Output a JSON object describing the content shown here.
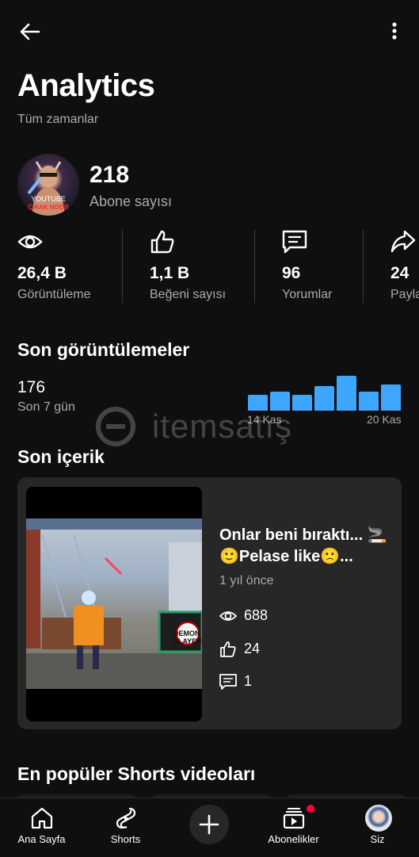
{
  "header": {
    "title": "Analytics",
    "subtitle": "Tüm zamanlar",
    "back_icon": "arrow-left-icon",
    "menu_icon": "more-vertical-icon"
  },
  "channel": {
    "avatar_text_line1": "YOUTUBE",
    "avatar_text_line2": "ÇIRAK NOOB",
    "subscribers": "218",
    "subscribers_label": "Abone sayısı"
  },
  "stats": [
    {
      "icon": "eye-icon",
      "value": "26,4 B",
      "label": "Görüntüleme"
    },
    {
      "icon": "thumbs-up-icon",
      "value": "1,1 B",
      "label": "Beğeni sayısı"
    },
    {
      "icon": "comment-icon",
      "value": "96",
      "label": "Yorumlar"
    },
    {
      "icon": "share-icon",
      "value": "24",
      "label": "Paylaşımlar"
    }
  ],
  "recent_views": {
    "title": "Son görüntülemeler",
    "value": "176",
    "period": "Son 7 gün",
    "start_label": "14 Kas",
    "end_label": "20 Kas",
    "daily_views_relative": [
      0.45,
      0.55,
      0.45,
      0.7,
      1.0,
      0.55,
      0.75
    ],
    "bar_color": "#3ea6ff"
  },
  "watermark": {
    "text": "itemsatış"
  },
  "recent_content": {
    "title": "Son içerik",
    "video": {
      "title": "Onlar beni bıraktı... 🚬🙂Pelase like🙁...",
      "date": "1 yıl önce",
      "thumb_badge": "DEMON SLAYER",
      "views": "688",
      "likes": "24",
      "comments": "1"
    }
  },
  "popular_shorts": {
    "title": "En popüler Shorts videoları"
  },
  "bottom_nav": [
    {
      "icon": "home-icon",
      "label": "Ana Sayfa"
    },
    {
      "icon": "shorts-icon",
      "label": "Shorts"
    },
    {
      "icon": "plus-icon",
      "label": ""
    },
    {
      "icon": "subscriptions-icon",
      "label": "Abonelikler",
      "has_notification": true
    },
    {
      "icon": "avatar",
      "label": "Siz"
    }
  ],
  "colors": {
    "background": "#0f0f0f",
    "card": "#272727",
    "secondary_text": "#aaaaaa",
    "accent": "#3ea6ff",
    "notification": "#ff0033"
  }
}
